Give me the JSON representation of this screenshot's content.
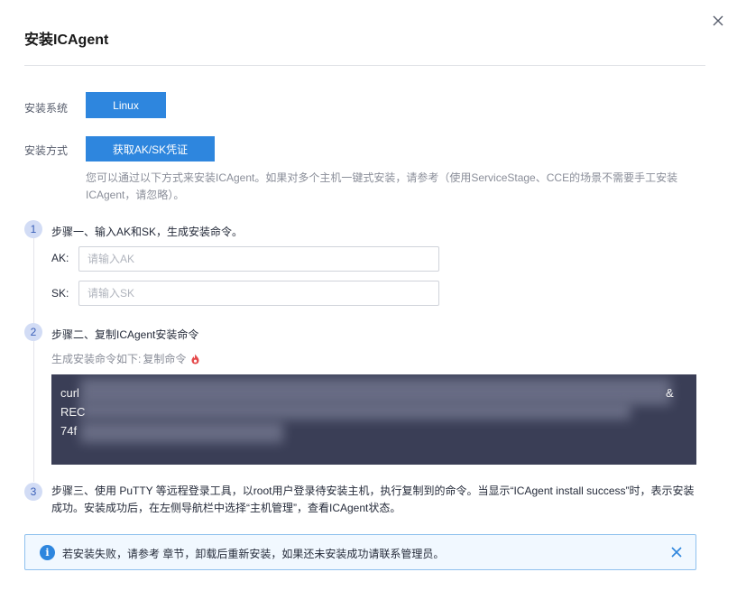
{
  "dialog": {
    "title": "安装ICAgent",
    "close_icon": "close-icon"
  },
  "install_system": {
    "label": "安装系统",
    "button": "Linux"
  },
  "install_method": {
    "label": "安装方式",
    "button": "获取AK/SK凭证",
    "description": "您可以通过以下方式来安装ICAgent。如果对多个主机一键式安装，请参考（使用ServiceStage、CCE的场景不需要手工安装ICAgent，请忽略）。"
  },
  "steps": [
    {
      "number": "1",
      "text": "步骤一、输入AK和SK，生成安装命令。"
    },
    {
      "number": "2",
      "text": "步骤二、复制ICAgent安装命令"
    },
    {
      "number": "3",
      "text": "步骤三、使用 PuTTY 等远程登录工具，以root用户登录待安装主机，执行复制到的命令。当显示“ICAgent install success”时，表示安装成功。安装成功后，在左侧导航栏中选择“主机管理”，查看ICAgent状态。"
    }
  ],
  "fields": {
    "ak_label": "AK:",
    "ak_placeholder": "请输入AK",
    "ak_value": "",
    "sk_label": "SK:",
    "sk_placeholder": "请输入SK",
    "sk_value": ""
  },
  "command": {
    "hint": "生成安装命令如下:",
    "copy_link": "复制命令",
    "lines": [
      "curl",
      "REC",
      "74f"
    ],
    "trailing_char": "&"
  },
  "alert": {
    "icon": "info-icon",
    "text": "若安装失败，请参考 章节，卸载后重新安装，如果还未安装成功请联系管理员。",
    "close_icon": "close-icon"
  },
  "colors": {
    "primary": "#2e86de",
    "command_bg": "#3a3e56",
    "alert_border": "#8fc1ee",
    "alert_bg": "#f1f8ff",
    "step_badge": "#d2dcf5"
  }
}
